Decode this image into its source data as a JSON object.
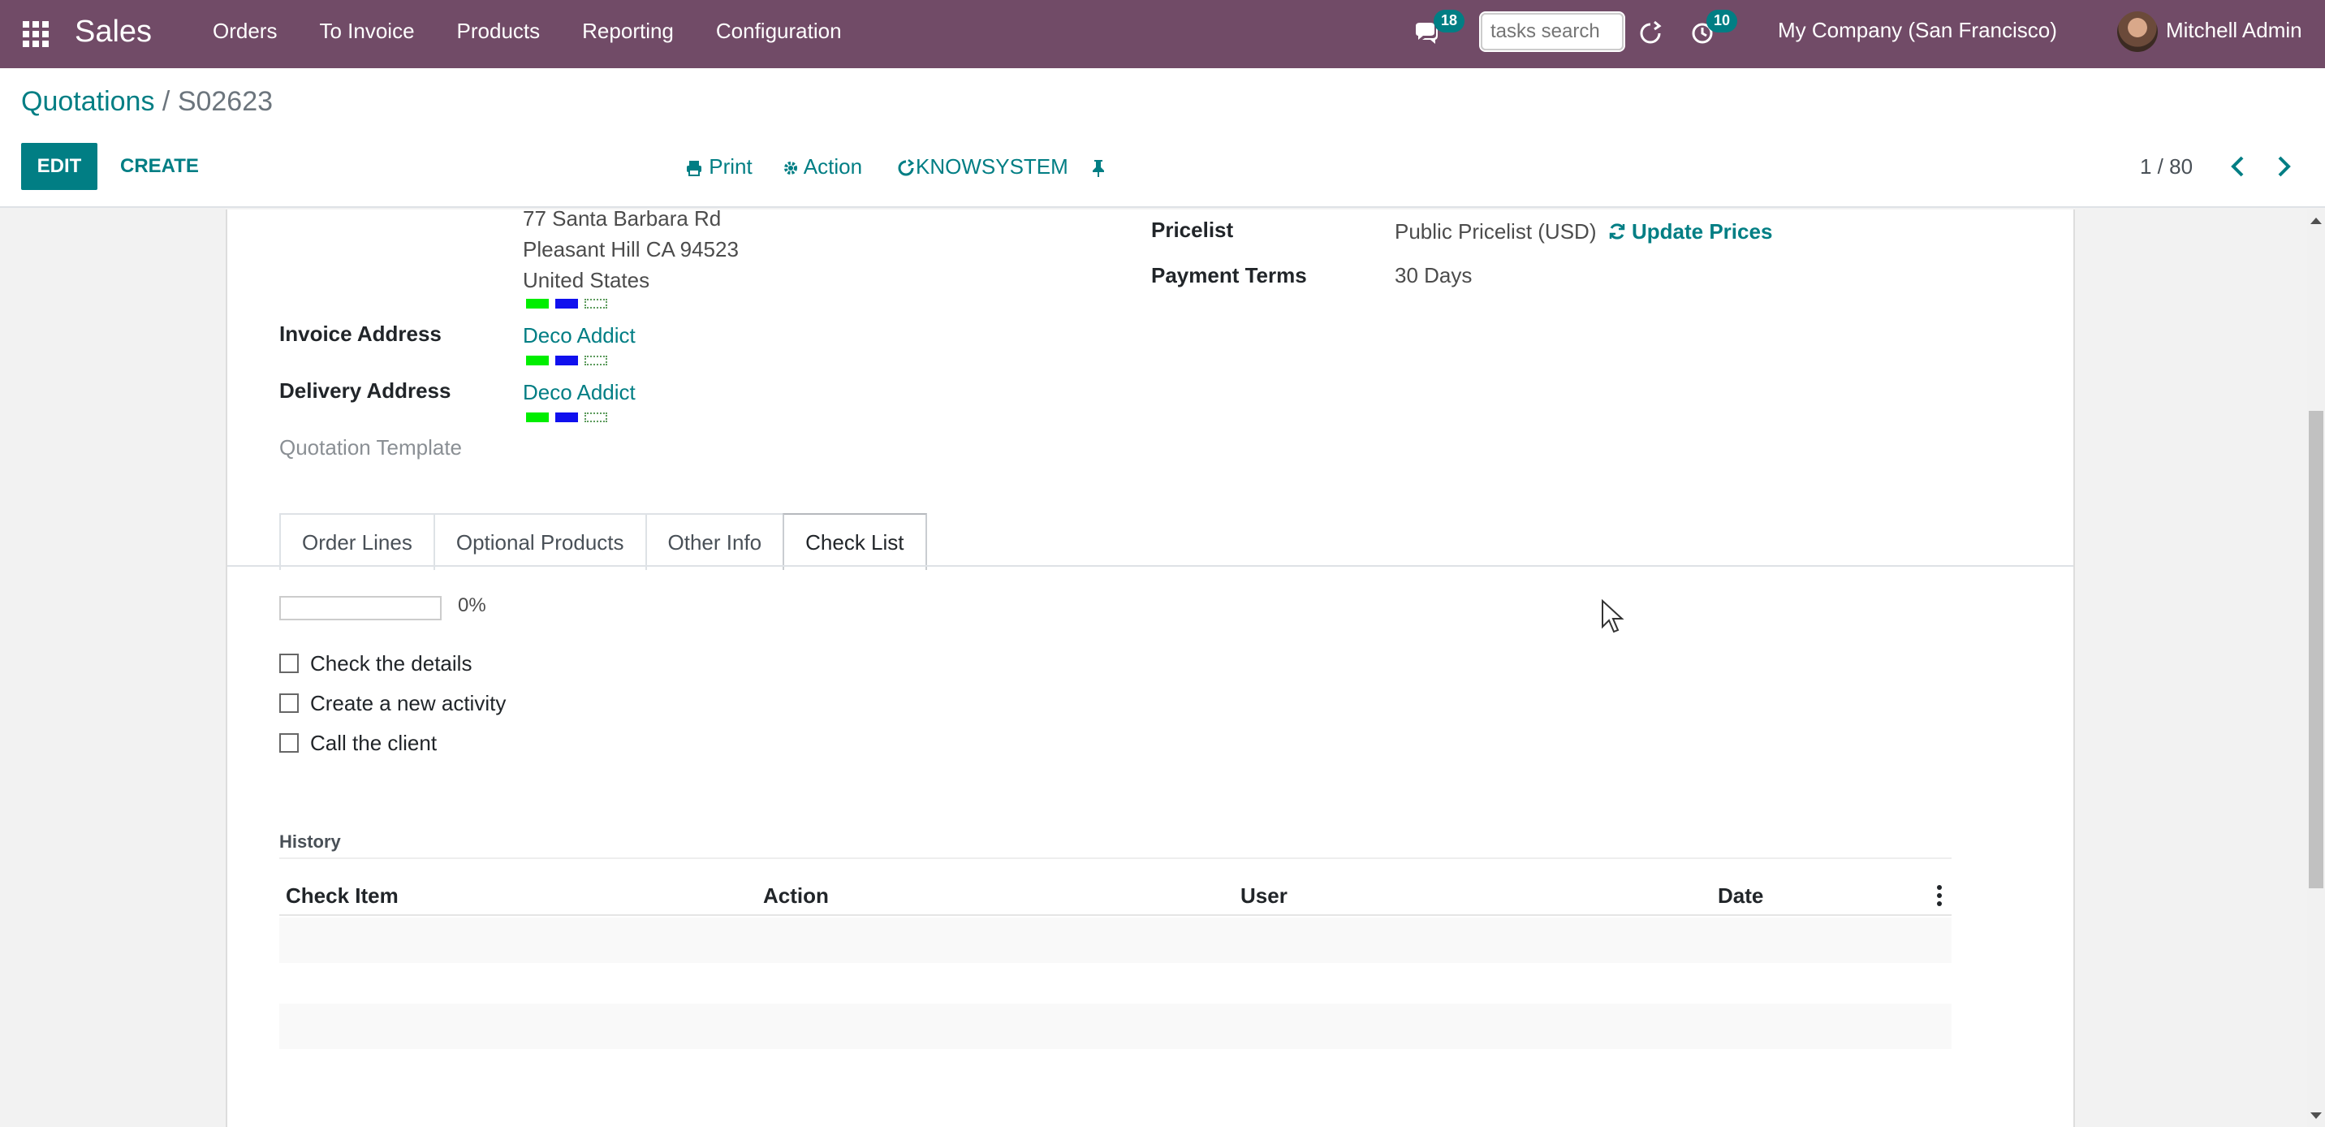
{
  "navbar": {
    "apps_icon": "apps-grid-icon",
    "brand": "Sales",
    "menu": [
      "Orders",
      "To Invoice",
      "Products",
      "Reporting",
      "Configuration"
    ],
    "messages_badge": "18",
    "search_placeholder": "tasks search",
    "activities_badge": "10",
    "company": "My Company (San Francisco)",
    "user": "Mitchell Admin"
  },
  "control_panel": {
    "breadcrumb_parent": "Quotations",
    "breadcrumb_sep": "/",
    "breadcrumb_current": "S02623",
    "edit_label": "EDIT",
    "create_label": "CREATE",
    "print_label": "Print",
    "action_label": "Action",
    "knowsystem_label": "KNOWSYSTEM",
    "pager": "1 / 80"
  },
  "form": {
    "address_lines": [
      "77 Santa Barbara Rd",
      "Pleasant Hill CA 94523",
      "United States"
    ],
    "invoice_address_label": "Invoice Address",
    "invoice_address_value": "Deco Addict",
    "delivery_address_label": "Delivery Address",
    "delivery_address_value": "Deco Addict",
    "quotation_template_label": "Quotation Template",
    "pricelist_label": "Pricelist",
    "pricelist_value": "Public Pricelist (USD)",
    "update_prices_label": "Update Prices",
    "payment_terms_label": "Payment Terms",
    "payment_terms_value": "30 Days",
    "tag_colors": [
      "#00ee00",
      "#1010ee"
    ]
  },
  "tabs": [
    "Order Lines",
    "Optional Products",
    "Other Info",
    "Check List"
  ],
  "active_tab": "Check List",
  "checklist": {
    "progress": 0,
    "progress_label": "0%",
    "items": [
      "Check the details",
      "Create a new activity",
      "Call the client"
    ]
  },
  "history": {
    "title": "History",
    "columns": [
      "Check Item",
      "Action",
      "User",
      "Date"
    ]
  },
  "colors": {
    "navbar": "#714B67",
    "accent": "#017e84"
  }
}
